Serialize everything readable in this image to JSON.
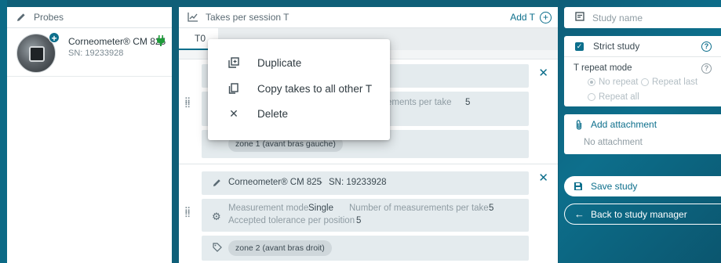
{
  "probes_panel": {
    "title": "Probes",
    "probe": {
      "name": "Corneometer® CM 825",
      "serial": "SN: 19233928"
    }
  },
  "takes_panel": {
    "title": "Takes per session T",
    "add_label": "Add T",
    "tabs": [
      {
        "label": "T0"
      }
    ],
    "block1": {
      "partial_text": "ements per take",
      "partial_count": "5",
      "chip": "zone 1 (avant bras gauche)"
    },
    "block2": {
      "probe_name": "Corneometer® CM 825",
      "probe_serial": "SN: 19233928",
      "separator": "-",
      "mode_label": "Measurement mode",
      "mode_value": "Single",
      "count_label": "Number of measurements per take",
      "count_value": "5",
      "tolerance_label": "Accepted tolerance per position",
      "tolerance_value": "5",
      "chip": "zone 2 (avant bras droit)"
    }
  },
  "context_menu": {
    "items": [
      {
        "label": "Duplicate",
        "icon": "duplicate-icon"
      },
      {
        "label": "Copy takes to all other T",
        "icon": "copy-icon"
      },
      {
        "label": "Delete",
        "icon": "close-icon"
      }
    ]
  },
  "sidebar": {
    "study_name_placeholder": "Study name",
    "strict_study_label": "Strict study",
    "strict_study_checked": true,
    "t_repeat_mode_label": "T repeat mode",
    "t_repeat_options": [
      {
        "label": "No repeat",
        "selected": true
      },
      {
        "label": "Repeat last",
        "selected": false
      },
      {
        "label": "Repeat all",
        "selected": false
      }
    ],
    "add_attachment_label": "Add attachment",
    "no_attachment_text": "No attachment",
    "save_label": "Save study",
    "back_label": "Back to study manager"
  },
  "colors": {
    "accent": "#0d6f8c",
    "background": "#0f5f78",
    "plug_connected": "#1f9b3a"
  }
}
